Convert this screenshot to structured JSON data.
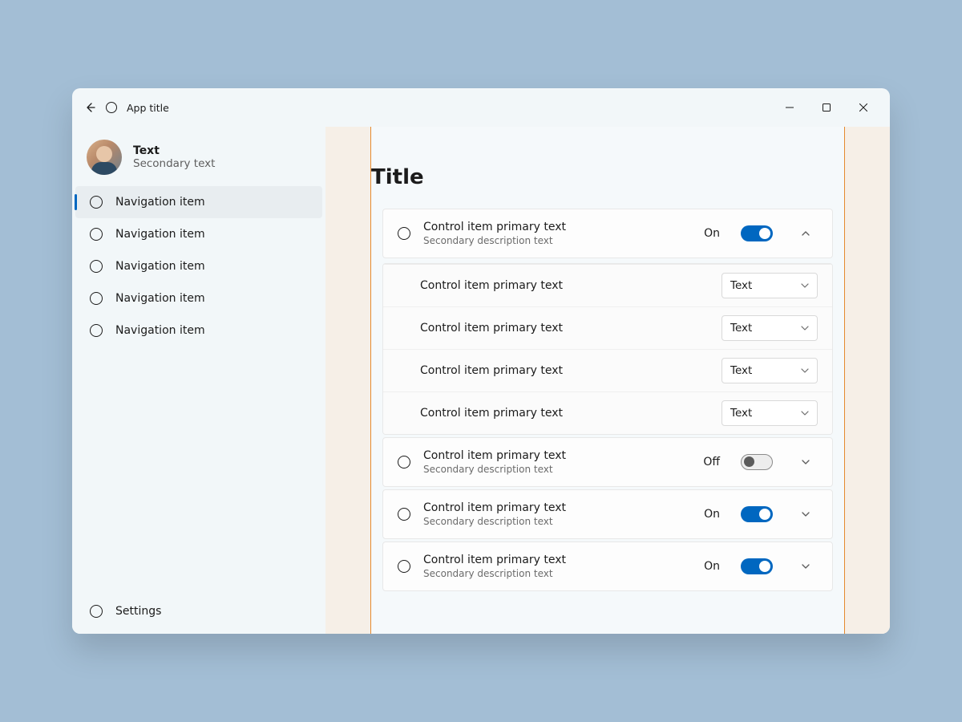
{
  "titlebar": {
    "app_title": "App title"
  },
  "profile": {
    "primary": "Text",
    "secondary": "Secondary text"
  },
  "sidebar": {
    "items": [
      {
        "label": "Navigation item",
        "selected": true
      },
      {
        "label": "Navigation item",
        "selected": false
      },
      {
        "label": "Navigation item",
        "selected": false
      },
      {
        "label": "Navigation item",
        "selected": false
      },
      {
        "label": "Navigation item",
        "selected": false
      }
    ],
    "settings_label": "Settings"
  },
  "page": {
    "title": "Title",
    "groups": [
      {
        "primary": "Control item primary text",
        "secondary": "Secondary description text",
        "toggle_state": "On",
        "toggle_on": true,
        "expanded": true,
        "children": [
          {
            "primary": "Control item primary text",
            "combo": "Text"
          },
          {
            "primary": "Control item primary text",
            "combo": "Text"
          },
          {
            "primary": "Control item primary text",
            "combo": "Text"
          },
          {
            "primary": "Control item primary text",
            "combo": "Text"
          }
        ]
      },
      {
        "primary": "Control item primary text",
        "secondary": "Secondary description text",
        "toggle_state": "Off",
        "toggle_on": false,
        "expanded": false
      },
      {
        "primary": "Control item primary text",
        "secondary": "Secondary description text",
        "toggle_state": "On",
        "toggle_on": true,
        "expanded": false
      },
      {
        "primary": "Control item primary text",
        "secondary": "Secondary description text",
        "toggle_state": "On",
        "toggle_on": true,
        "expanded": false
      }
    ]
  }
}
